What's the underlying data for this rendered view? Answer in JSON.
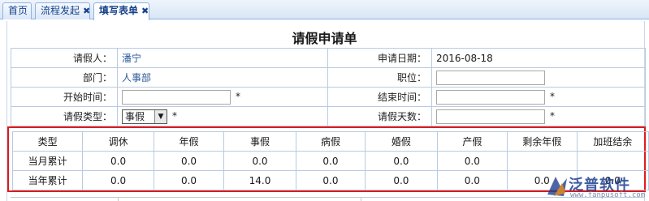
{
  "tabs": [
    {
      "label": "首页",
      "closable": false
    },
    {
      "label": "流程发起",
      "closable": true
    },
    {
      "label": "填写表单",
      "closable": true,
      "active": true
    }
  ],
  "close_glyph": "✖",
  "form": {
    "title": "请假申请单",
    "applicant_label": "请假人：",
    "applicant_value": "潘宁",
    "apply_date_label": "申请日期：",
    "apply_date_value": "2016-08-18",
    "department_label": "部门：",
    "department_value": "人事部",
    "position_label": "职位：",
    "position_value": "",
    "start_time_label": "开始时间：",
    "start_time_value": "",
    "end_time_label": "结束时间：",
    "end_time_value": "",
    "leave_type_label": "请假类型：",
    "leave_type_value": "事假",
    "leave_days_label": "请假天数：",
    "leave_days_value": "",
    "required_mark": "*"
  },
  "summary": {
    "headers": [
      "类型",
      "调休",
      "年假",
      "事假",
      "病假",
      "婚假",
      "产假",
      "剩余年假",
      "加班结余"
    ],
    "rows": [
      {
        "label": "当月累计",
        "cells": [
          "0.0",
          "0.0",
          "0.0",
          "0.0",
          "0.0",
          "0.0",
          "",
          ""
        ]
      },
      {
        "label": "当年累计",
        "cells": [
          "0.0",
          "0.0",
          "14.0",
          "0.0",
          "0.0",
          "0.0",
          "0.0",
          "0.0"
        ]
      }
    ]
  },
  "watermark": {
    "text": "泛普软件",
    "url": "www.fanpusoft.com"
  },
  "colors": {
    "highlight_border": "#e01b1b",
    "tab_text": "#15428b",
    "value_text": "#2c5a9c"
  }
}
